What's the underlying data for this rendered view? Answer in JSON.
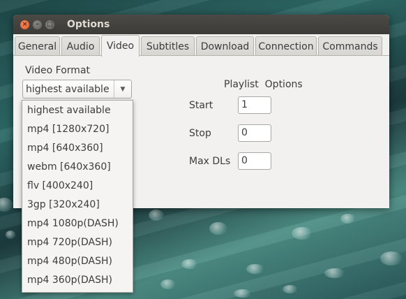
{
  "window": {
    "title": "Options",
    "controls": {
      "close": "×",
      "minimize": "–",
      "maximize": "□"
    }
  },
  "tabs": [
    {
      "label": "General"
    },
    {
      "label": "Audio"
    },
    {
      "label": "Video",
      "active": true
    },
    {
      "label": "Subtitles"
    },
    {
      "label": "Download"
    },
    {
      "label": "Connection"
    },
    {
      "label": "Commands"
    }
  ],
  "video": {
    "format_label": "Video Format",
    "format_selected": "highest available",
    "format_options": [
      "highest available",
      "mp4 [1280x720]",
      "mp4 [640x360]",
      "webm [640x360]",
      "flv [400x240]",
      "3gp [320x240]",
      "mp4 1080p(DASH)",
      "mp4 720p(DASH)",
      "mp4 480p(DASH)",
      "mp4 360p(DASH)"
    ]
  },
  "playlist": {
    "title": "Playlist  Options",
    "start_label": "Start",
    "start_value": "1",
    "stop_label": "Stop",
    "stop_value": "0",
    "max_label": "Max DLs",
    "max_value": "0"
  },
  "colors": {
    "titlebar": "#3c3b37",
    "close_button": "#e05a26",
    "window_bg": "#f2f1f0"
  }
}
